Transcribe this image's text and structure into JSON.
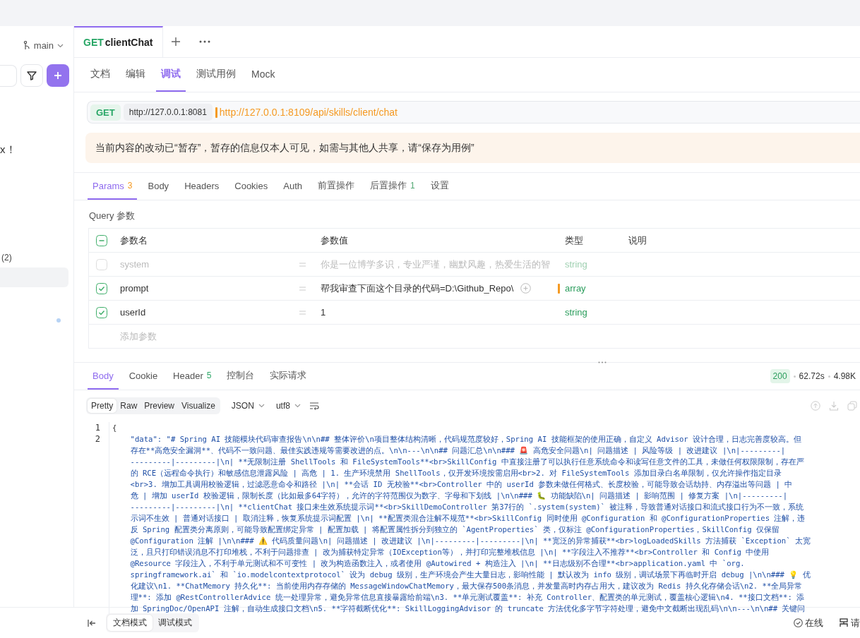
{
  "sidebar": {
    "branch": "main",
    "text_1": "x！",
    "count": "(2)"
  },
  "request_tabs": [
    {
      "method": "GET",
      "label": "clientChat",
      "selected": true
    }
  ],
  "mode_tabs": [
    {
      "label": "文档",
      "selected": false
    },
    {
      "label": "编辑",
      "selected": false
    },
    {
      "label": "调试",
      "selected": true
    },
    {
      "label": "测试用例",
      "selected": false
    },
    {
      "label": "Mock",
      "selected": false
    }
  ],
  "url_bar": {
    "method": "GET",
    "base_url": "http://127.0.0.1:8081",
    "url": "http://127.0.0.1:8109/api/skills/client/chat"
  },
  "notice": "当前内容的改动已“暂存”，暂存的信息仅本人可见，如需与其他人共享，请“保存为用例”",
  "param_tabs": [
    {
      "label": "Params",
      "badge": "3",
      "color": "#f59a23",
      "selected": true
    },
    {
      "label": "Body",
      "selected": false
    },
    {
      "label": "Headers",
      "selected": false
    },
    {
      "label": "Cookies",
      "selected": false
    },
    {
      "label": "Auth",
      "selected": false
    },
    {
      "label": "前置操作",
      "selected": false
    },
    {
      "label": "后置操作",
      "badge": "1",
      "color": "#52a873",
      "selected": false
    },
    {
      "label": "设置",
      "selected": false
    }
  ],
  "query": {
    "title": "Query 参数",
    "columns": [
      "参数名",
      "参数值",
      "类型",
      "说明"
    ],
    "rows": [
      {
        "checked": false,
        "name": "system",
        "value": "你是一位博学多识，专业严谨，幽默风趣，热爱生活的智",
        "type": "string",
        "flagged": false
      },
      {
        "checked": true,
        "name": "prompt",
        "value": "帮我审查下面这个目录的代码=D:\\Github_Repo\\",
        "type": "array",
        "flagged": true
      },
      {
        "checked": true,
        "name": "userId",
        "value": "1",
        "type": "string",
        "flagged": false
      }
    ],
    "add_placeholder": "添加参数"
  },
  "response": {
    "tabs": [
      {
        "label": "Body",
        "selected": true
      },
      {
        "label": "Cookie",
        "selected": false
      },
      {
        "label": "Header",
        "badge": "5",
        "color": "#2fa86a",
        "selected": false
      },
      {
        "label": "控制台",
        "selected": false
      },
      {
        "label": "实际请求",
        "selected": false
      }
    ],
    "status": "200",
    "time": "62.72s",
    "size": "4.98K",
    "view_tabs": [
      {
        "label": "Pretty",
        "selected": true
      },
      {
        "label": "Raw",
        "selected": false
      },
      {
        "label": "Preview",
        "selected": false
      },
      {
        "label": "Visualize",
        "selected": false
      }
    ],
    "format": "JSON",
    "encoding": "utf8",
    "lines": [
      {
        "number": "1",
        "text": [
          "{"
        ]
      },
      {
        "number": "2",
        "text": [
          "    \"data\": \"# Spring AI 技能模块代码审查报告\\n\\n## 整体评价\\n项目整体结构清晰，代码规范度较好，Spring AI 技能框架的使用正确，自定义 Advisor 设计合理，日志完善度较高。但",
          "    存在**高危安全漏洞**、代码不一致问题、最佳实践违规等需要改进的点。\\n\\n---\\n\\n## 问题汇总\\n\\n### 🚨 高危安全问题\\n| 问题描述 | 风险等级 | 改进建议 |\\n|---------|",
          "    ---------|---------|\\n| **无限制注册 ShellTools 和 FileSystemTools**<br>SkillConfig 中直接注册了可以执行任意系统命令和读写任意文件的工具，未做任何权限限制，存在严",
          "    的 RCE（远程命令执行）和敏感信息泄露风险 | 高危 | 1. 生产环境禁用 ShellTools，仅开发环境按需启用<br>2. 对 FileSystemTools 添加目录白名单限制，仅允许操作指定目录",
          "    <br>3. 增加工具调用校验逻辑，过滤恶意命令和路径 |\\n| **会话 ID 无校验**<br>Controller 中的 userId 参数未做任何格式、长度校验，可能导致会话劫持、内存溢出等问题 | 中",
          "    危 | 增加 userId 校验逻辑，限制长度（比如最多64字符），允许的字符范围仅为数字、字母和下划线 |\\n\\n### 🐛 功能缺陷\\n| 问题描述 | 影响范围 | 修复方案 |\\n|---------|",
          "    ---------|---------|\\n| **clientChat 接口未生效系统提示词**<br>SkillDemoController 第37行的 `.system(system)` 被注释，导致普通对话接口和流式接口行为不一致，系统",
          "    示词不生效 | 普通对话接口 | 取消注释，恢复系统提示词配置 |\\n| **配置类混合注解不规范**<br>SkillConfig 同时使用 @Configuration 和 @ConfigurationProperties 注解，违",
          "    反 Spring 配置类分离原则，可能导致配置绑定异常 | 配置加载 | 将配置属性拆分到独立的 `AgentProperties` 类，仅标注 @ConfigurationProperties，SkillConfig 仅保留",
          "    @Configuration 注解 |\\n\\n### ⚠️ 代码质量问题\\n| 问题描述 | 改进建议 |\\n|---------|---------|\\n| **宽泛的异常捕获**<br>logLoadedSkills 方法捕获 `Exception` 太宽",
          "    泛，且只打印错误消息不打印堆栈，不利于问题排查 | 改为捕获特定异常（IOException等），并打印完整堆栈信息 |\\n| **字段注入不推荐**<br>Controller 和 Config 中使用",
          "    @Resource 字段注入，不利于单元测试和不可变性 | 改为构造函数注入，或者使用 @Autowired + 构造注入 |\\n| **日志级别不合理**<br>application.yaml 中 `org.",
          "    springframework.ai` 和 `io.modelcontextprotocol` 设为 debug 级别，生产环境会产生大量日志，影响性能 | 默认改为 info 级别，调试场景下再临时开启 debug |\\n\\n### 💡 优",
          "    化建议\\n1. **ChatMemory 持久化**: 当前使用内存存储的 MessageWindowChatMemory，最大保存500条消息，并发量高时内存占用大，建议改为 Redis 持久化存储会话\\n2. **全局异常",
          "    理**: 添加 @RestControllerAdvice 统一处理异常，避免异常信息直接暴露给前端\\n3. **单元测试覆盖**: 补充 Controller、配置类的单元测试，覆盖核心逻辑\\n4. **接口文档**: 添",
          "    加 SpringDoc/OpenAPI 注解，自动生成接口文档\\n5. **字符截断优化**: SkillLoggingAdvisor 的 truncate 方法优化多字节字符处理，避免中文截断出现乱码\\n\\n---\\n\\n## 关键问"
        ]
      }
    ]
  },
  "footer": {
    "modes": [
      {
        "label": "文档模式",
        "selected": true
      },
      {
        "label": "调试模式",
        "selected": false
      }
    ],
    "status": "在线",
    "text_2": "请"
  }
}
